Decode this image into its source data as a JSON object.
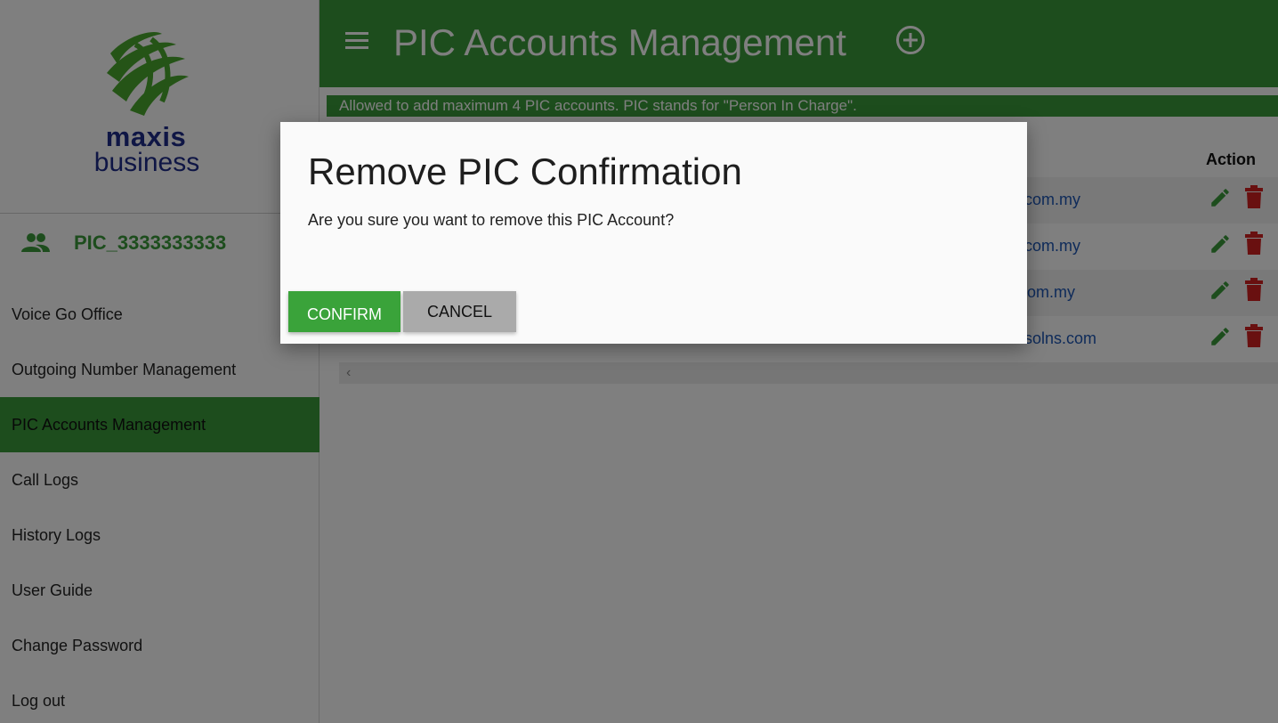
{
  "brand": {
    "logo_line1": "maxis",
    "logo_line2": "business",
    "green": "#3a9a3a",
    "navy": "#1f2c8a",
    "danger": "#d32020"
  },
  "user": {
    "name": "PIC_3333333333",
    "icon": "people-icon"
  },
  "sidebar": {
    "items": [
      {
        "label": "Voice Go Office"
      },
      {
        "label": "Outgoing Number Management"
      },
      {
        "label": "PIC Accounts Management",
        "active": true
      },
      {
        "label": "Call Logs"
      },
      {
        "label": "History Logs"
      },
      {
        "label": "User Guide"
      },
      {
        "label": "Change Password"
      },
      {
        "label": "Log out"
      }
    ]
  },
  "header": {
    "title": "PIC Accounts Management",
    "menu_icon": "hamburger-icon",
    "add_icon": "add-circle-icon"
  },
  "info_banner": "Allowed to add maximum 4 PIC accounts. PIC stands for \"Person In Charge\".",
  "table": {
    "action_header": "Action",
    "rows": [
      {
        "email_visible": "com.my"
      },
      {
        "email_visible": "com.my"
      },
      {
        "email_visible": "s.com.my"
      },
      {
        "email_visible": "solns.com"
      }
    ],
    "edit_icon": "pencil-icon",
    "delete_icon": "trash-icon"
  },
  "dialog": {
    "title": "Remove PIC Confirmation",
    "message": "Are you sure you want to remove this PIC Account?",
    "confirm_label": "CONFIRM",
    "cancel_label": "CANCEL"
  }
}
